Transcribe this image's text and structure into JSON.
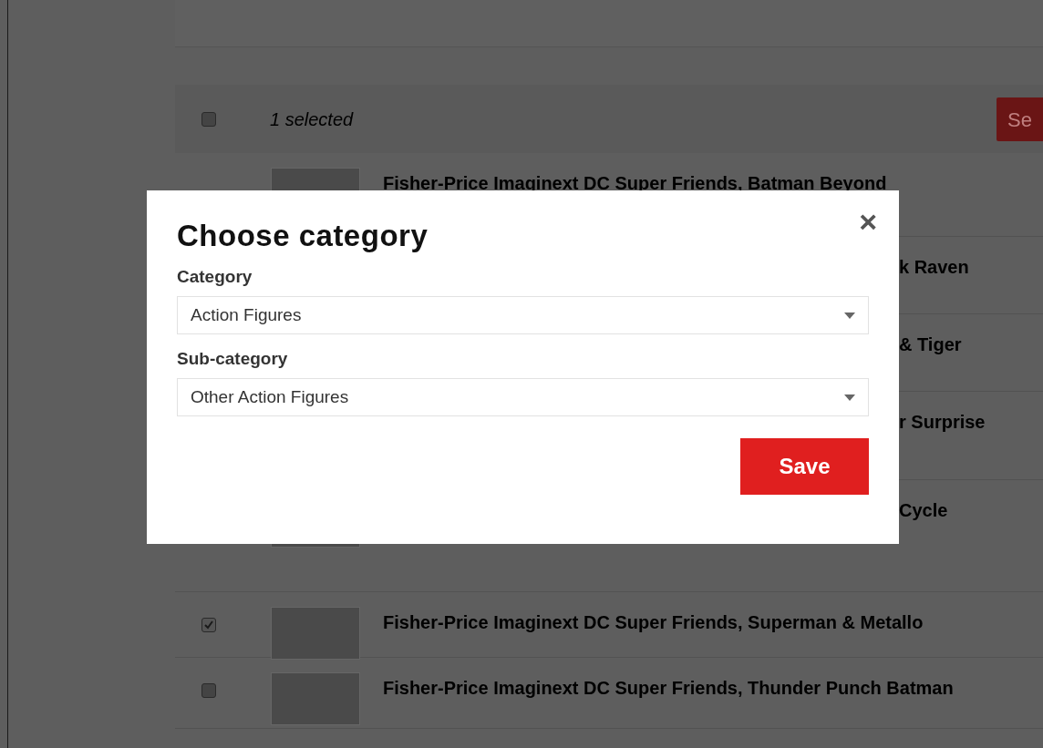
{
  "toolbar": {
    "select_all_checked": false,
    "selection_text": "1 selected",
    "action_button": "Se"
  },
  "products": [
    {
      "title": "Fisher-Price Imaginext DC Super Friends, Batman Beyond",
      "covered": false,
      "photo": true
    },
    {
      "title": "k Raven",
      "covered": true,
      "photo": false
    },
    {
      "title": "& Tiger",
      "covered": true,
      "photo": false
    },
    {
      "title": "r Surprise",
      "covered": true,
      "photo": false
    },
    {
      "title": "Cycle",
      "covered": true,
      "photo": true
    },
    {
      "title": "Fisher-Price Imaginext DC Super Friends, Superman & Metallo",
      "covered": false,
      "photo": true,
      "checked": true
    },
    {
      "title": "Fisher-Price Imaginext DC Super Friends, Thunder Punch Batman",
      "covered": false,
      "photo": true,
      "checked": false
    }
  ],
  "modal": {
    "title": "Choose category",
    "close": "×",
    "fields": [
      {
        "label": "Category",
        "value": "Action Figures"
      },
      {
        "label": "Sub-category",
        "value": "Other Action Figures"
      }
    ],
    "save_button": "Save"
  }
}
